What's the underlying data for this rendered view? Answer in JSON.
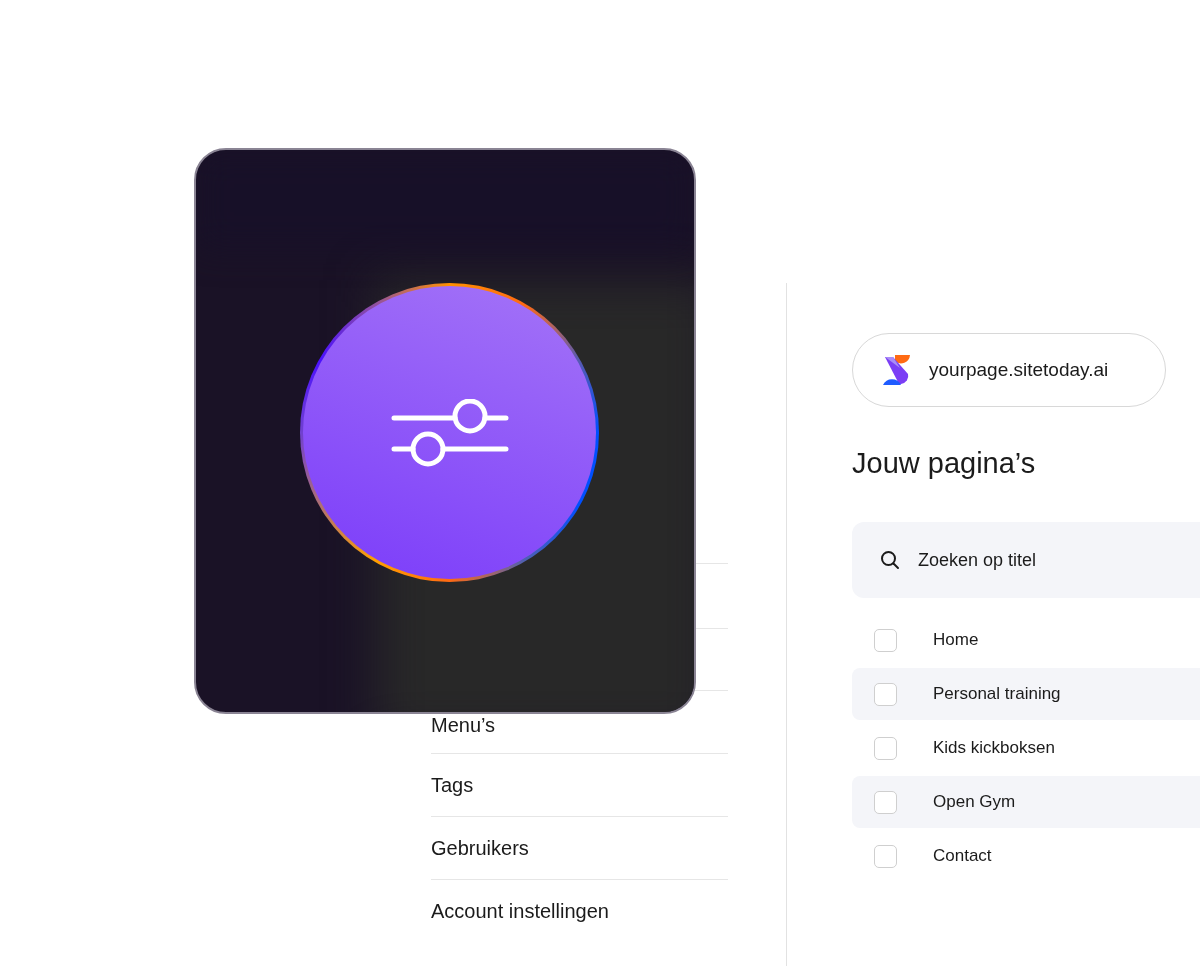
{
  "menu_items": [
    {
      "label": "Menu’s"
    },
    {
      "label": "Tags"
    },
    {
      "label": "Gebruikers"
    },
    {
      "label": "Account instellingen"
    }
  ],
  "site": {
    "url": "yourpage.sitetoday.ai"
  },
  "pages_title": "Jouw pagina’s",
  "search": {
    "placeholder": "Zoeken op titel"
  },
  "pages": [
    {
      "label": "Home",
      "checked": false
    },
    {
      "label": "Personal training",
      "checked": false
    },
    {
      "label": "Kids kickboksen",
      "checked": false
    },
    {
      "label": "Open Gym",
      "checked": false
    },
    {
      "label": "Contact",
      "checked": false
    }
  ]
}
